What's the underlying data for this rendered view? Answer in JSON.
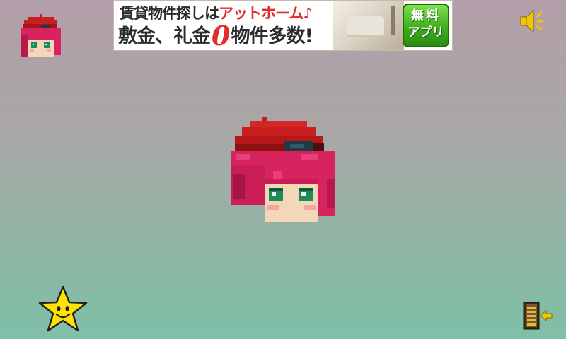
{
  "ad": {
    "line1_plain": "賃貸物件探しは",
    "line1_highlight": "アットホーム♪",
    "line2_part1": "敷金、礼金",
    "line2_zero": "0",
    "line2_part2": "物件多数!",
    "button_line1": "無料",
    "button_line2": "アプリ",
    "button_color": "#3fae1f"
  },
  "icons": {
    "avatar": "character-head-icon",
    "sound": "speaker-mute-icon",
    "star": "smiling-star-icon",
    "exit": "exit-door-icon"
  },
  "colors": {
    "beret": "#c81e1e",
    "hair": "#d8245e",
    "eyes": "#1f8a5a",
    "skin": "#f3d7b8",
    "star": "#ffe400",
    "sound": "#f0c800"
  }
}
